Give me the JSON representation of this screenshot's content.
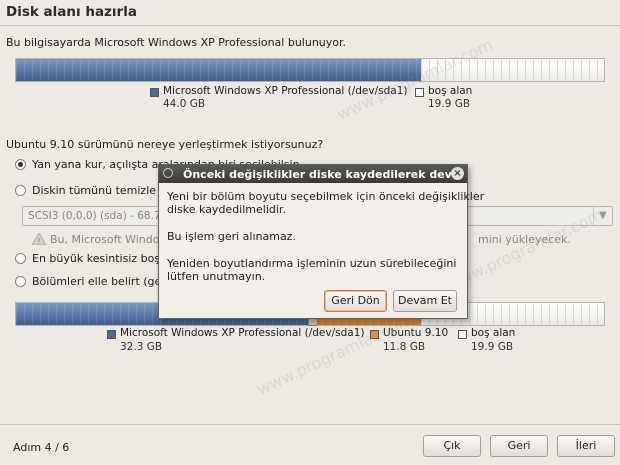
{
  "page": {
    "title": "Disk alanı hazırla",
    "detected_os_text": "Bu bilgisayarda Microsoft Windows XP Professional bulunuyor.",
    "question": "Ubuntu 9.10 sürümünü nereye yerleştirmek istiyorsunuz?",
    "step": "Adım 4 / 6"
  },
  "current_disk": {
    "legend": [
      {
        "label": "Microsoft Windows XP Professional (/dev/sda1)",
        "size": "44.0 GB",
        "color": "#4b6a9b"
      },
      {
        "label": "boş alan",
        "size": "19.9 GB",
        "color": "#ffffff"
      }
    ],
    "fractions": [
      0.689,
      0.311
    ]
  },
  "options": [
    {
      "label": "Yan yana kur, açılışta aralarından biri seçilebilsin",
      "selected": true,
      "enabled": true
    },
    {
      "label": "Diskin tümünü temizle ve kullan",
      "selected": false,
      "enabled": true
    },
    {
      "label": "En büyük kesintisiz boş alanı kullan",
      "selected": false,
      "enabled": true
    },
    {
      "label": "Bölümleri elle belirt (gelişmiş)",
      "selected": false,
      "enabled": true
    }
  ],
  "disk_select": {
    "value": "SCSI3 (0,0,0) (sda) - 68.7 GB ATA VBOX HARDDISK"
  },
  "warning": {
    "left_text": "Bu, Microsoft Windows XP Professional (/dev/sda1)",
    "right_text": "mini yükleyecek."
  },
  "new_disk": {
    "legend": [
      {
        "label": "Microsoft Windows XP Professional (/dev/sda1)",
        "size": "32.3 GB",
        "color": "#4b6a9b"
      },
      {
        "label": "Ubuntu 9.10",
        "size": "11.8 GB",
        "color": "#e08f3c"
      },
      {
        "label": "boş alan",
        "size": "19.9 GB",
        "color": "#ffffff"
      }
    ],
    "fractions": [
      0.506,
      0.183,
      0.311
    ]
  },
  "dialog": {
    "title": "Önceki değişiklikler diske kaydedilerek dev",
    "close_symbol": "×",
    "line1": "Yeni bir bölüm boyutu seçebilmek için önceki değişiklikler",
    "line2": "diske kaydedilmelidir.",
    "line3": "Bu işlem geri alınamaz.",
    "line4": "Yeniden boyutlandırma işleminin uzun sürebileceğini",
    "line5": "lütfen unutmayın.",
    "back_label": "Geri Dön",
    "continue_label": "Devam Et"
  },
  "footer": {
    "quit_label": "Çık",
    "back_label": "Geri",
    "forward_label": "İleri"
  },
  "watermark": "www.programlar.com"
}
